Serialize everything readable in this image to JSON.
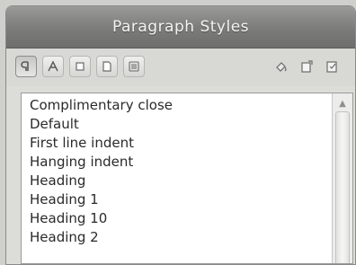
{
  "window": {
    "title": "Paragraph Styles"
  },
  "toolbar": {
    "buttons": [
      {
        "icon": "paragraph-styles-icon",
        "tooltip": ""
      },
      {
        "icon": "character-styles-icon",
        "tooltip": ""
      },
      {
        "icon": "frame-styles-icon",
        "tooltip": ""
      },
      {
        "icon": "page-styles-icon",
        "tooltip": ""
      },
      {
        "icon": "list-styles-icon",
        "tooltip": ""
      },
      {
        "icon": "fill-format-mode-icon",
        "tooltip": ""
      },
      {
        "icon": "new-style-from-selection-icon",
        "tooltip": ""
      },
      {
        "icon": "update-style-icon",
        "tooltip": ""
      }
    ]
  },
  "styles_list": {
    "items": [
      "Complimentary close",
      "Default",
      "First line indent",
      "Hanging indent",
      "Heading",
      "Heading 1",
      "Heading 10",
      "Heading 2"
    ]
  },
  "colors": {
    "titlebar": "#7b7b79",
    "title_text": "#f4f4f2",
    "panel": "#dcdcd9",
    "list_bg": "#ffffff"
  }
}
